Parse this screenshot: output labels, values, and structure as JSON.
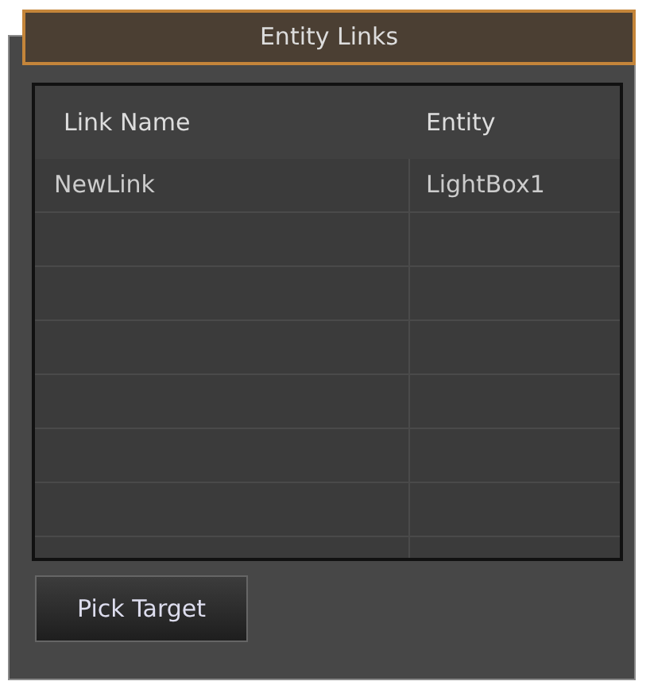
{
  "panel": {
    "title": "Entity Links"
  },
  "table": {
    "columns": [
      "Link Name",
      "Entity"
    ],
    "rows": [
      {
        "cells": [
          "NewLink",
          "LightBox1"
        ]
      }
    ]
  },
  "buttons": [
    "Pick Target"
  ]
}
